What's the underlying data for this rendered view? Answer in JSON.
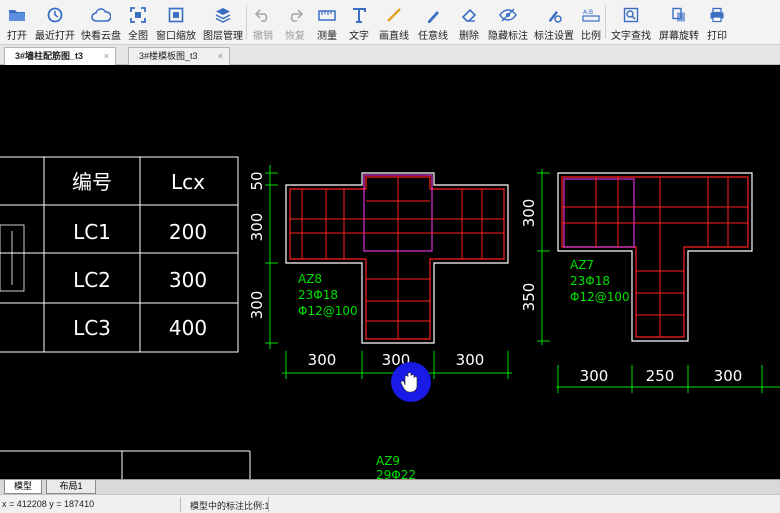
{
  "toolbar": {
    "items": [
      {
        "label": "打开",
        "icon": "folder-open-icon"
      },
      {
        "label": "最近打开",
        "icon": "clock-icon"
      },
      {
        "label": "快看云盘",
        "icon": "cloud-icon"
      },
      {
        "label": "全图",
        "icon": "fit-view-icon"
      },
      {
        "label": "窗口缩放",
        "icon": "window-zoom-icon"
      },
      {
        "label": "图层管理",
        "icon": "layers-icon"
      },
      {
        "label": "撤销",
        "icon": "undo-icon"
      },
      {
        "label": "恢复",
        "icon": "redo-icon"
      },
      {
        "label": "测量",
        "icon": "measure-icon"
      },
      {
        "label": "文字",
        "icon": "text-icon"
      },
      {
        "label": "画直线",
        "icon": "line-icon"
      },
      {
        "label": "任意线",
        "icon": "freehand-icon"
      },
      {
        "label": "删除",
        "icon": "eraser-icon"
      },
      {
        "label": "隐藏标注",
        "icon": "eye-slash-icon"
      },
      {
        "label": "标注设置",
        "icon": "annotation-settings-icon"
      },
      {
        "label": "比例",
        "icon": "scale-icon"
      },
      {
        "label": "文字查找",
        "icon": "text-search-icon"
      },
      {
        "label": "屏幕旋转",
        "icon": "rotate-icon"
      },
      {
        "label": "打印",
        "icon": "print-icon"
      }
    ]
  },
  "tabs": [
    {
      "label": "3#墙柱配筋图_t3",
      "close": "×"
    },
    {
      "label": "3#楼模板图_t3",
      "close": "×"
    }
  ],
  "drawing": {
    "table": {
      "header": [
        "编号",
        "Lcx"
      ],
      "rows": [
        [
          "LC1",
          "200"
        ],
        [
          "LC2",
          "300"
        ],
        [
          "LC3",
          "400"
        ]
      ]
    },
    "column_az8": {
      "name": "AZ8",
      "main_rebar": "23Φ18",
      "stirrup": "Φ12@100",
      "dims_left": [
        "50",
        "300",
        "300"
      ],
      "dims_bottom": [
        "300",
        "300",
        "300"
      ]
    },
    "column_az7": {
      "name": "AZ7",
      "main_rebar": "23Φ18",
      "stirrup": "Φ12@100",
      "dims_left": [
        "300",
        "350"
      ],
      "dims_bottom": [
        "300",
        "250",
        "300"
      ]
    },
    "column_az9": {
      "name": "AZ9",
      "main_rebar": "29Φ22"
    },
    "colors": {
      "outline": "#ffffff",
      "rebar": "#ff2020",
      "stirrup_magenta": "#ff40ff",
      "dim": "#00dd00",
      "label": "#00e000",
      "cursor": "#1a1ae6"
    }
  },
  "layout_tabs": [
    "模型",
    "布局1"
  ],
  "status": {
    "coords": "x = 412208  y = 187410",
    "scale": "模型中的标注比例:1"
  }
}
